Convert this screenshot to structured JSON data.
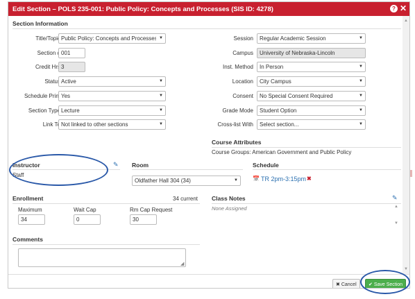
{
  "dialog": {
    "title": "Edit Section – POLS 235-001: Public Policy: Concepts and Processes (SIS ID: 4278)",
    "help_icon": "question-circle-icon",
    "close_icon": "close-icon"
  },
  "section_info": {
    "heading": "Section Information",
    "left": [
      {
        "label": "Title/Topic",
        "value": "Public Policy: Concepts and Processes (D",
        "type": "select"
      },
      {
        "label": "Section #",
        "value": "001",
        "type": "input"
      },
      {
        "label": "Credit Hrs",
        "value": "3",
        "type": "input-disabled"
      },
      {
        "label": "Status",
        "value": "Active",
        "type": "select"
      },
      {
        "label": "Schedule Print",
        "value": "Yes",
        "type": "select"
      },
      {
        "label": "Section Type",
        "value": "Lecture",
        "type": "select"
      },
      {
        "label": "Link To",
        "value": "Not linked to other sections",
        "type": "select"
      }
    ],
    "right": [
      {
        "label": "Session",
        "value": "Regular Academic Session",
        "type": "select"
      },
      {
        "label": "Campus",
        "value": "University of Nebraska-Lincoln",
        "type": "select-disabled"
      },
      {
        "label": "Inst. Method",
        "value": "In Person",
        "type": "select"
      },
      {
        "label": "Location",
        "value": "City Campus",
        "type": "select"
      },
      {
        "label": "Consent",
        "value": "No Special Consent Required",
        "type": "select"
      },
      {
        "label": "Grade Mode",
        "value": "Student Option",
        "type": "select"
      },
      {
        "label": "Cross-list With",
        "value": "Select section...",
        "type": "select"
      }
    ]
  },
  "course_attributes": {
    "heading": "Course Attributes",
    "text": "Course Groups: American Government and Public Policy"
  },
  "instructor": {
    "heading": "Instructor",
    "value": "Staff"
  },
  "room": {
    "heading": "Room",
    "value": "Oldfather Hall 304 (34)"
  },
  "schedule": {
    "heading": "Schedule",
    "value": "TR 2pm-3:15pm"
  },
  "enrollment": {
    "heading": "Enrollment",
    "current": "34 current",
    "maximum_label": "Maximum",
    "maximum_value": "34",
    "wait_cap_label": "Wait Cap",
    "wait_cap_value": "0",
    "rm_cap_label": "Rm Cap Request",
    "rm_cap_value": "30"
  },
  "class_notes": {
    "heading": "Class Notes",
    "value": "None Assigned"
  },
  "comments": {
    "heading": "Comments",
    "value": ""
  },
  "footer": {
    "cancel_label": "Cancel",
    "save_label": "Save Section"
  },
  "colors": {
    "title_bar": "#c8202f",
    "save_button": "#4cae4c",
    "annotation_oval": "#2958a8",
    "link": "#2a6fb0"
  }
}
